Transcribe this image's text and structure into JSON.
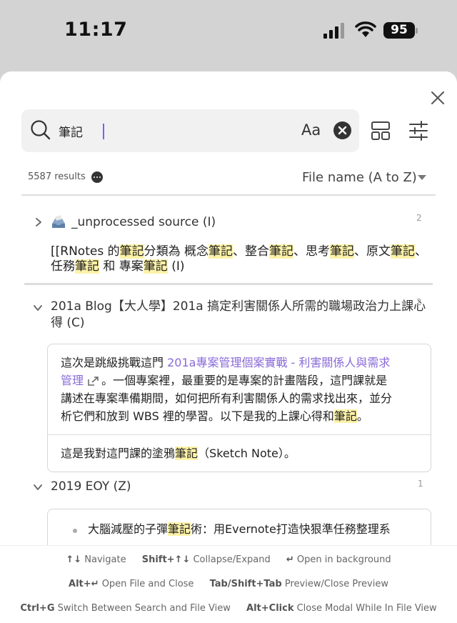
{
  "status": {
    "time": "11:17",
    "battery": "95"
  },
  "search": {
    "query": "筆記",
    "match_case_label": "Aa"
  },
  "results": {
    "count_label": "5587 results",
    "sort_label": "File name (A to Z)"
  },
  "groups": [
    {
      "title_prefix": "_unprocessed source",
      "title_suffix": " (I)",
      "count": "2",
      "match": {
        "l1": [
          "[[RNotes 的",
          "筆記",
          "分類為 概念",
          "筆記",
          "、整合",
          "筆記",
          "、思考",
          "筆記",
          "、原文",
          "筆記",
          "、"
        ],
        "l2": [
          "任務",
          "筆記",
          " 和 專案",
          "筆記",
          " (I)"
        ]
      }
    },
    {
      "title_l1": "201a Blog【大人學】201a 搞定利害關係人所需的職場政治力上課心",
      "title_l2": "得 (C)",
      "count": "2",
      "card1": {
        "t1": "這次是跳級挑戰這門 ",
        "link1": "201a專案管理個案實戰 - 利害關係人與需求",
        "link2": "管理",
        "t2": "。一個專案裡，最重要的是專案的計畫階段，這門課就是",
        "t3": "講述在專案準備期間，如何把所有利害關係人的需求找出來，並分",
        "t4": "析它們和放到 WBS 裡的學習。以下是我的上課心得和",
        "hl": "筆記",
        "t5": "。"
      },
      "card2": {
        "t1": "這是我對這門課的塗鴉",
        "hl": "筆記",
        "t2": "（Sketch Note）。"
      }
    },
    {
      "title": "2019 EOY (Z)",
      "count": "1",
      "bullet": {
        "t1": "大腦減壓的子彈",
        "hl": "筆記",
        "t2": "術：用Evernote打造快狠準任務整理系"
      }
    }
  ],
  "footer": {
    "row1": [
      {
        "key": "↑↓",
        "desc": "Navigate"
      },
      {
        "key": "Shift+↑↓",
        "desc": "Collapse/Expand"
      },
      {
        "key": "↵",
        "desc": "Open in background"
      }
    ],
    "row2": [
      {
        "key": "Alt+↵",
        "desc": "Open File and Close"
      },
      {
        "key": "Tab/Shift+Tab",
        "desc": "Preview/Close Preview"
      }
    ],
    "row3": [
      {
        "key": "Ctrl+G",
        "desc": "Switch Between Search and File View"
      },
      {
        "key": "Alt+Click",
        "desc": "Close Modal While In File View"
      }
    ]
  }
}
